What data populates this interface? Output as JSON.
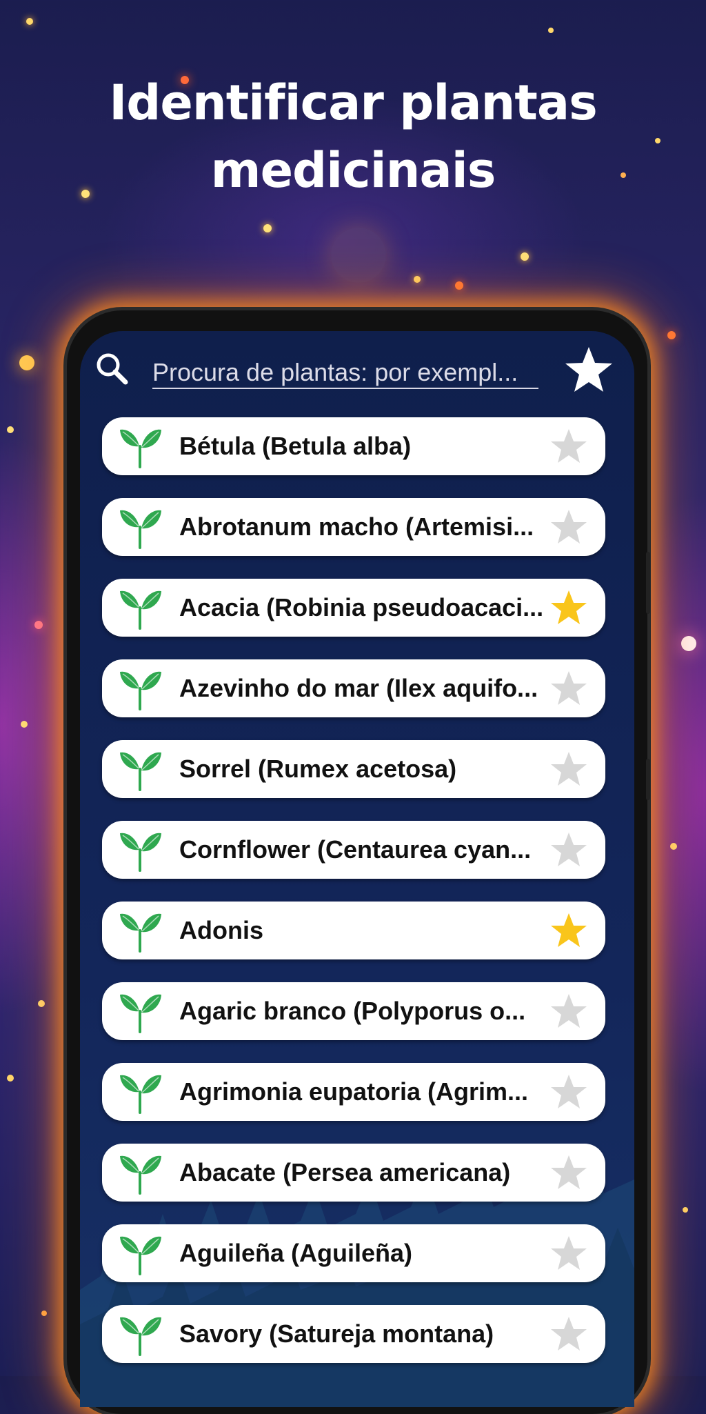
{
  "headline": {
    "line1": "Identificar plantas",
    "line2": "medicinais"
  },
  "search": {
    "placeholder": "Procura de plantas: por exempl..."
  },
  "icons": {
    "search": "search-icon",
    "favorites_filter": "star-icon",
    "plant": "sprout-icon",
    "favorite": "star-icon"
  },
  "colors": {
    "leaf": "#2fa84f",
    "star_on": "#f9c51b",
    "star_off": "#d7d7d7",
    "glow": "#ff8c1e"
  },
  "plants": [
    {
      "name": "Bétula (Betula alba)",
      "favorite": false
    },
    {
      "name": "Abrotanum macho (Artemisi...",
      "favorite": false
    },
    {
      "name": "Acacia (Robinia pseudoacaci...",
      "favorite": true
    },
    {
      "name": "Azevinho do mar (Ilex aquifo...",
      "favorite": false
    },
    {
      "name": "Sorrel (Rumex acetosa)",
      "favorite": false
    },
    {
      "name": "Cornflower (Centaurea cyan...",
      "favorite": false
    },
    {
      "name": "Adonis",
      "favorite": true
    },
    {
      "name": "Agaric branco (Polyporus o...",
      "favorite": false
    },
    {
      "name": "Agrimonia eupatoria (Agrim...",
      "favorite": false
    },
    {
      "name": "Abacate (Persea americana)",
      "favorite": false
    },
    {
      "name": "Aguileña (Aguileña)",
      "favorite": false
    },
    {
      "name": "Savory (Satureja montana)",
      "favorite": false
    }
  ]
}
